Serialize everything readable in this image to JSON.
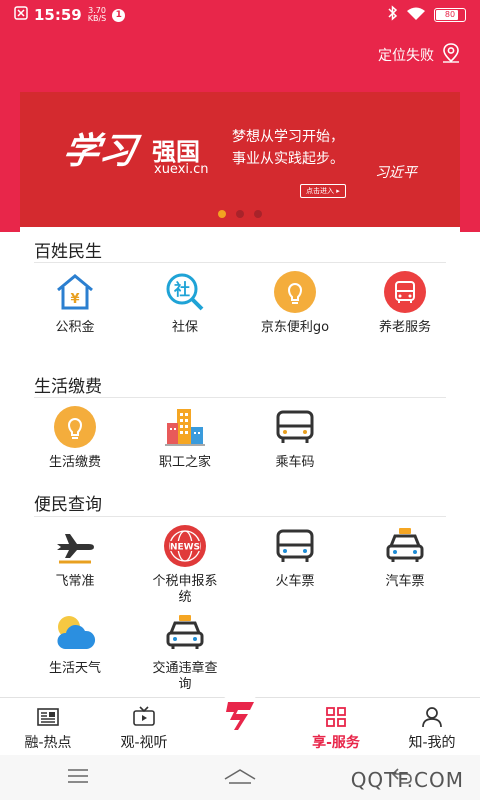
{
  "status_bar": {
    "time": "15:59",
    "speed": "3.70",
    "speed_unit": "KB/S",
    "notification_count": "1",
    "battery": "80"
  },
  "header": {
    "location_text": "定位失败"
  },
  "banner": {
    "logo_script": "学习",
    "logo_main": "强国",
    "logo_url": "xuexi.cn",
    "slogan_line1": "梦想从学习开始，",
    "slogan_line2": "事业从实践起步。",
    "signature": "习近平",
    "button": "点击进入 ▸",
    "slide_count": 3,
    "active_slide": 0
  },
  "sections": [
    {
      "title": "百姓民生",
      "items": [
        {
          "label": "公积金",
          "icon": "house-yen-icon"
        },
        {
          "label": "社保",
          "icon": "social-security-search-icon"
        },
        {
          "label": "京东便利go",
          "icon": "lightbulb-icon"
        },
        {
          "label": "养老服务",
          "icon": "bus-red-icon"
        }
      ]
    },
    {
      "title": "生活缴费",
      "items": [
        {
          "label": "生活缴费",
          "icon": "lightbulb-icon"
        },
        {
          "label": "职工之家",
          "icon": "buildings-icon"
        },
        {
          "label": "乘车码",
          "icon": "bus-icon"
        }
      ]
    },
    {
      "title": "便民查询",
      "items": [
        {
          "label": "飞常准",
          "icon": "airplane-icon"
        },
        {
          "label": "个税申报系统",
          "icon": "news-globe-icon"
        },
        {
          "label": "火车票",
          "icon": "train-icon"
        },
        {
          "label": "汽车票",
          "icon": "taxi-icon"
        },
        {
          "label": "生活天气",
          "icon": "weather-icon"
        },
        {
          "label": "交通违章查询",
          "icon": "taxi-icon"
        }
      ]
    }
  ],
  "tabs": [
    {
      "label": "融-热点",
      "icon": "newspaper-icon"
    },
    {
      "label": "观-视听",
      "icon": "tv-icon"
    },
    {
      "label": "",
      "icon": "center-logo-icon"
    },
    {
      "label": "享-服务",
      "icon": "grid-icon"
    },
    {
      "label": "知-我的",
      "icon": "person-icon"
    }
  ],
  "watermark": "QQTF.COM",
  "colors": {
    "brand_red": "#e8264a",
    "banner_red": "#d42a2f",
    "orange": "#f2a321",
    "blue": "#1f8dd6"
  }
}
